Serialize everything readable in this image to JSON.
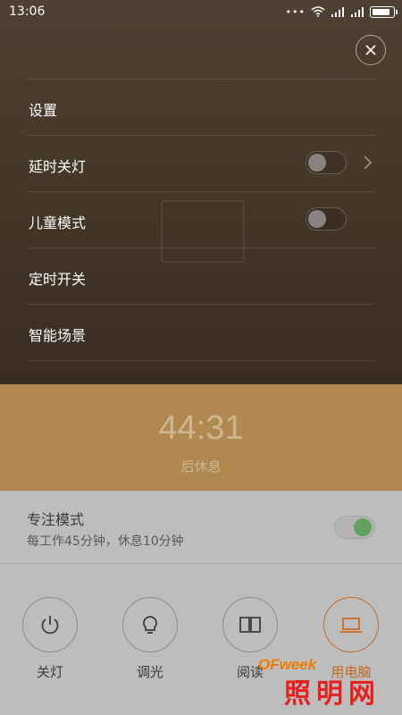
{
  "status_bar": {
    "time": "13:06",
    "dots": "•••",
    "battery_level": 0.85
  },
  "menu": {
    "items": [
      {
        "label": "设置"
      },
      {
        "label": "延时关灯",
        "toggle": "off",
        "chevron": true
      },
      {
        "label": "儿童模式",
        "toggle": "off"
      },
      {
        "label": "定时开关"
      },
      {
        "label": "智能场景"
      }
    ],
    "close_icon": "close-icon"
  },
  "timer": {
    "value": "44:31",
    "subtitle": "后休息"
  },
  "focus_mode": {
    "title": "专注模式",
    "description": "每工作45分钟，休息10分钟",
    "enabled": true,
    "accent": "#60a260"
  },
  "controls": [
    {
      "label": "关灯",
      "icon": "power-icon",
      "active": false
    },
    {
      "label": "调光",
      "icon": "bulb-icon",
      "active": false
    },
    {
      "label": "阅读",
      "icon": "book-icon",
      "active": false
    },
    {
      "label": "用电脑",
      "icon": "laptop-icon",
      "active": true
    }
  ],
  "colors": {
    "timer_band": "#b08850",
    "active_accent": "#cc6a20"
  },
  "watermark": {
    "ofweek": "OFweek",
    "brand": "照明网"
  }
}
